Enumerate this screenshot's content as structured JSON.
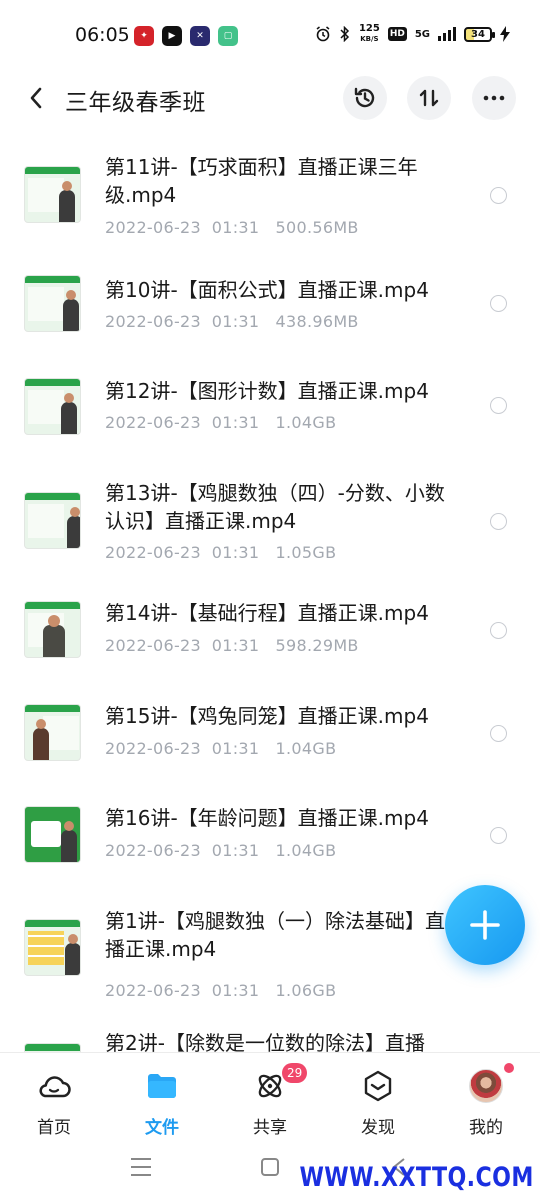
{
  "status_bar": {
    "time": "06:05",
    "net_speed_value": "125",
    "net_speed_unit": "KB/S",
    "hd_label": "HD",
    "network": "5G",
    "battery": "34"
  },
  "header": {
    "title": "三年级春季班",
    "back_icon": "chevron-left-icon",
    "actions": [
      "history-icon",
      "sort-icon",
      "more-icon"
    ]
  },
  "files": [
    {
      "name": "第11讲-【巧求面积】直播正课三年级.mp4",
      "date": "2022-06-23  01:31",
      "size": "500.56MB"
    },
    {
      "name": "第10讲-【面积公式】直播正课.mp4",
      "date": "2022-06-23  01:31",
      "size": "438.96MB"
    },
    {
      "name": "第12讲-【图形计数】直播正课.mp4",
      "date": "2022-06-23  01:31",
      "size": "1.04GB"
    },
    {
      "name": "第13讲-【鸡腿数独（四）-分数、小数认识】直播正课.mp4",
      "date": "2022-06-23  01:31",
      "size": "1.05GB"
    },
    {
      "name": "第14讲-【基础行程】直播正课.mp4",
      "date": "2022-06-23  01:31",
      "size": "598.29MB"
    },
    {
      "name": "第15讲-【鸡兔同笼】直播正课.mp4",
      "date": "2022-06-23  01:31",
      "size": "1.04GB"
    },
    {
      "name": "第16讲-【年龄问题】直播正课.mp4",
      "date": "2022-06-23  01:31",
      "size": "1.04GB"
    },
    {
      "name": "第1讲-【鸡腿数独（一）除法基础】直播正课.mp4",
      "date": "2022-06-23  01:31",
      "size": "1.06GB"
    },
    {
      "name": "第2讲-【除数是一位数的除法】直播",
      "date": "",
      "size": ""
    }
  ],
  "fab": {
    "icon": "plus-icon"
  },
  "tabs": [
    {
      "label": "首页",
      "icon": "cloud-home-icon",
      "active": false
    },
    {
      "label": "文件",
      "icon": "folder-icon",
      "active": true
    },
    {
      "label": "共享",
      "icon": "share-orbit-icon",
      "active": false,
      "badge": "29"
    },
    {
      "label": "发现",
      "icon": "discover-icon",
      "active": false
    },
    {
      "label": "我的",
      "icon": "avatar",
      "active": false,
      "dot": true
    }
  ],
  "colors": {
    "accent": "#1e9bf0",
    "badge": "#f0476a",
    "meta_text": "#a3a8b0"
  },
  "watermark": "WWW.XXTTQ.COM"
}
